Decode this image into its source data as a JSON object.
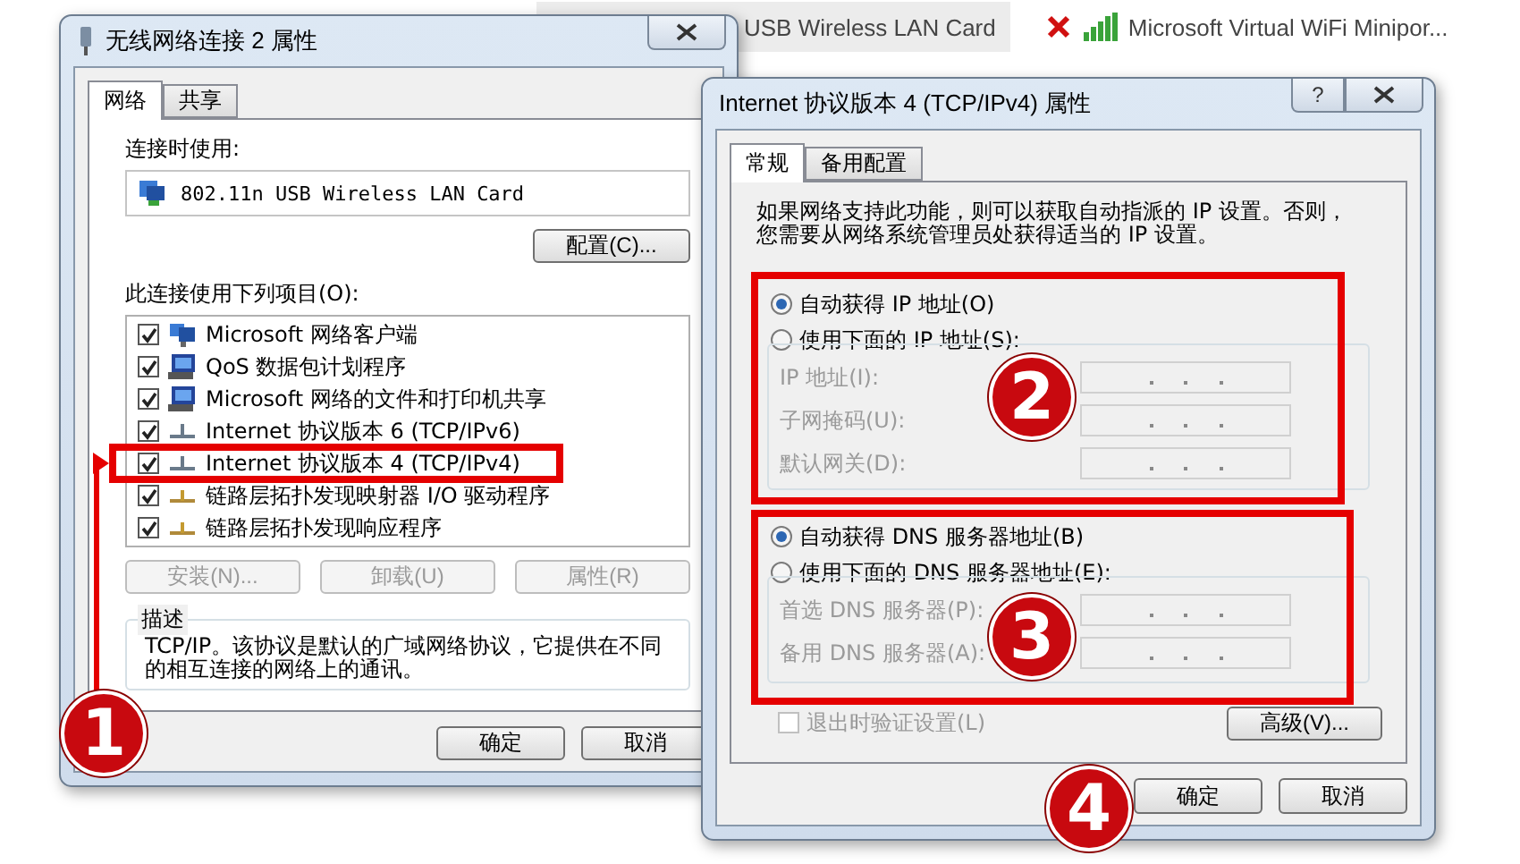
{
  "background_connections": [
    {
      "name": "USB Wireless LAN Card",
      "disconnected": false,
      "selected": true
    },
    {
      "name": "Microsoft Virtual WiFi Minipor...",
      "disconnected": true,
      "selected": false
    }
  ],
  "left_dialog": {
    "title": "无线网络连接 2 属性",
    "tabs": [
      {
        "label": "网络",
        "selected": true
      },
      {
        "label": "共享",
        "selected": false
      }
    ],
    "connect_using_label": "连接时使用:",
    "adapter": "802.11n USB Wireless LAN Card",
    "configure_button": "配置(C)...",
    "items_label": "此连接使用下列项目(O):",
    "items": [
      {
        "label": "Microsoft 网络客户端",
        "checked": true,
        "kind": "client"
      },
      {
        "label": "QoS 数据包计划程序",
        "checked": true,
        "kind": "service"
      },
      {
        "label": "Microsoft 网络的文件和打印机共享",
        "checked": true,
        "kind": "service"
      },
      {
        "label": "Internet 协议版本 6 (TCP/IPv6)",
        "checked": true,
        "kind": "protocol"
      },
      {
        "label": "Internet 协议版本 4 (TCP/IPv4)",
        "checked": true,
        "kind": "protocol"
      },
      {
        "label": "链路层拓扑发现映射器 I/O 驱动程序",
        "checked": true,
        "kind": "topology"
      },
      {
        "label": "链路层拓扑发现响应程序",
        "checked": true,
        "kind": "topology"
      }
    ],
    "buttons": [
      {
        "label": "安装(N)...",
        "disabled": true
      },
      {
        "label": "卸载(U)",
        "disabled": true
      },
      {
        "label": "属性(R)",
        "disabled": true
      }
    ],
    "description": {
      "legend": "描述",
      "text": "TCP/IP。该协议是默认的广域网络协议，它提供在不同的相互连接的网络上的通讯。"
    },
    "footer_buttons": [
      {
        "label": "确定"
      },
      {
        "label": "取消"
      }
    ]
  },
  "right_dialog": {
    "title": "Internet 协议版本 4 (TCP/IPv4) 属性",
    "help": "?",
    "tabs": [
      {
        "label": "常规",
        "selected": true
      },
      {
        "label": "备用配置",
        "selected": false
      }
    ],
    "intro": "如果网络支持此功能，则可以获取自动指派的 IP 设置。否则，您需要从网络系统管理员处获得适当的 IP 设置。",
    "ip_options": [
      {
        "label": "自动获得 IP 地址(O)",
        "selected": true
      },
      {
        "label": "使用下面的 IP 地址(S):",
        "selected": false
      }
    ],
    "ip_fields": [
      {
        "label": "IP 地址(I):",
        "disabled": true
      },
      {
        "label": "子网掩码(U):",
        "disabled": true
      },
      {
        "label": "默认网关(D):",
        "disabled": true
      }
    ],
    "dns_options": [
      {
        "label": "自动获得 DNS 服务器地址(B)",
        "selected": true
      },
      {
        "label": "使用下面的 DNS 服务器地址(E):",
        "selected": false
      }
    ],
    "dns_fields": [
      {
        "label": "首选 DNS 服务器(P):",
        "disabled": true
      },
      {
        "label": "备用 DNS 服务器(A):",
        "disabled": true
      }
    ],
    "validate": {
      "label": "退出时验证设置(L)",
      "checked": false,
      "disabled": true
    },
    "advanced_button": "高级(V)...",
    "footer_buttons": [
      {
        "label": "确定"
      },
      {
        "label": "取消"
      }
    ]
  },
  "annotations": {
    "badges": [
      "1",
      "2",
      "3",
      "4"
    ]
  }
}
